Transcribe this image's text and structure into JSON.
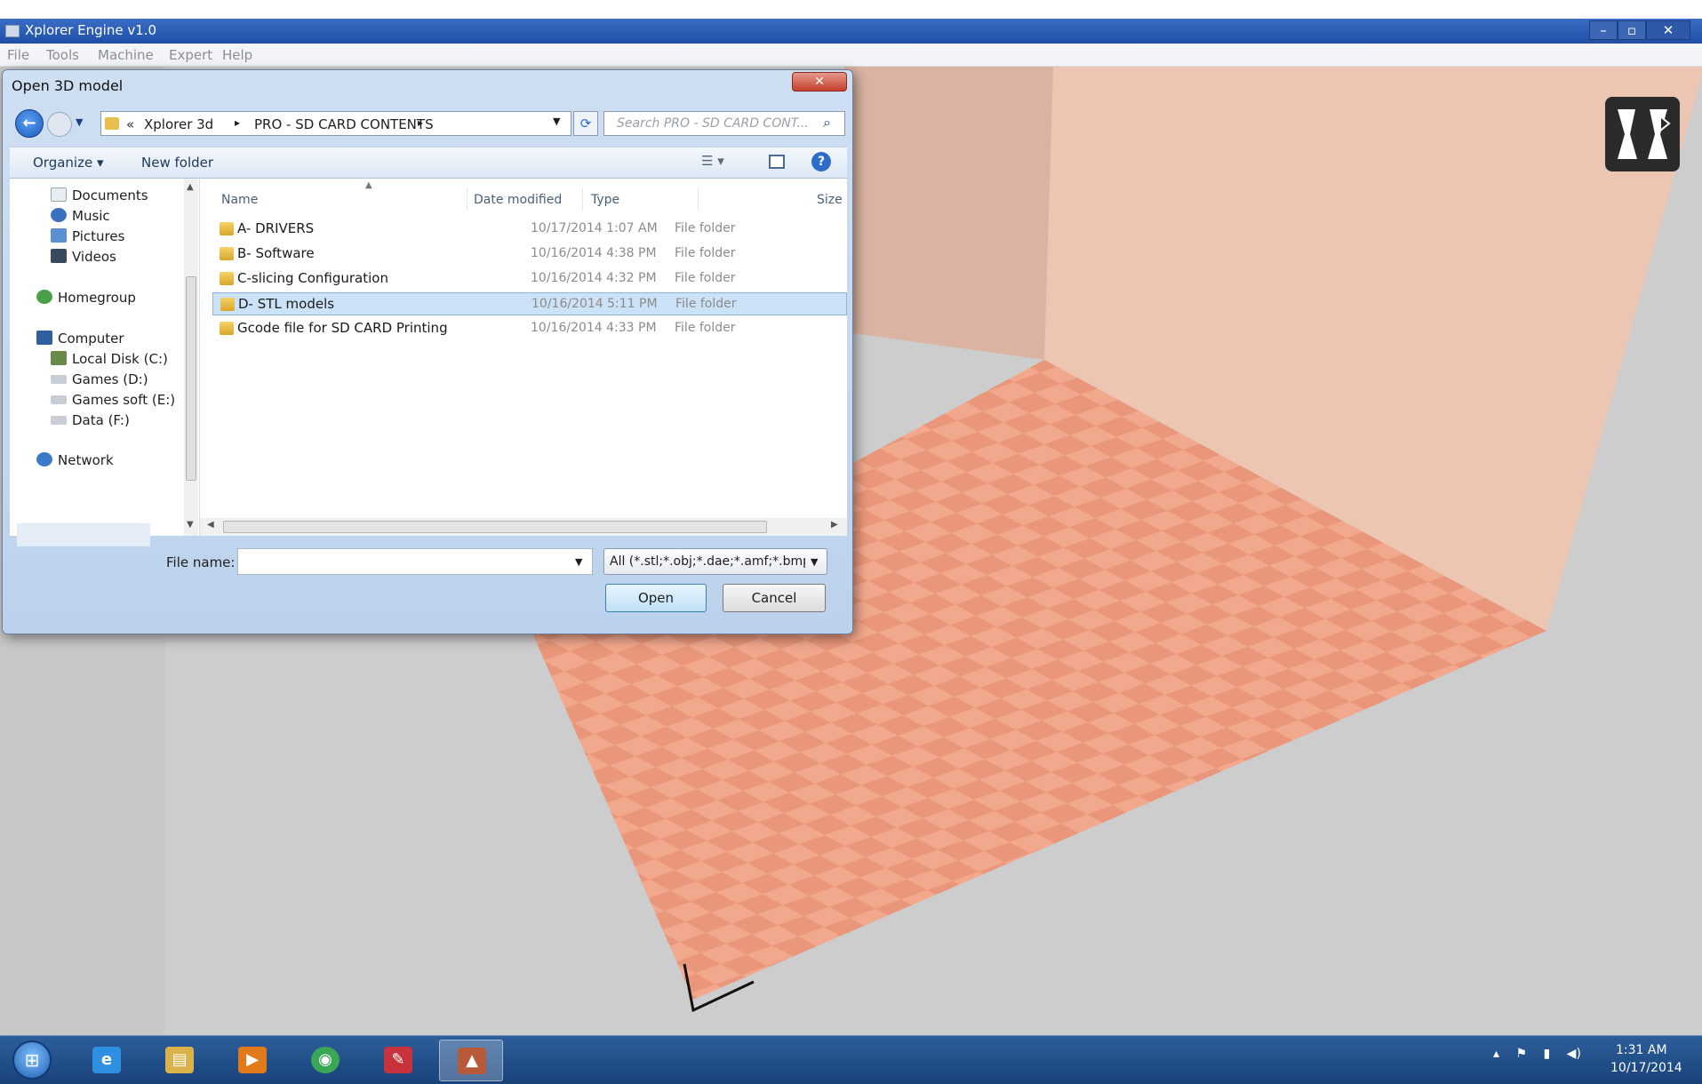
{
  "app": {
    "title": "Xplorer Engine v1.0",
    "menu": [
      "File",
      "Tools",
      "Machine",
      "Expert",
      "Help"
    ],
    "window_controls": {
      "minimize": "–",
      "maximize": "▫",
      "close": "✕"
    },
    "logo_icon": "xplorer-logo-icon"
  },
  "dialog": {
    "title": "Open 3D model",
    "close_glyph": "✕",
    "address": {
      "prefix": "«",
      "crumbs": [
        "Xplorer 3d",
        "PRO - SD CARD CONTENTS"
      ],
      "separator": "▸"
    },
    "search_placeholder": "Search PRO - SD CARD CONT...",
    "toolbar": {
      "organize": "Organize ▾",
      "new_folder": "New folder",
      "help": "?",
      "view": "☰ ▾"
    },
    "nav": {
      "libraries": [
        "Documents",
        "Music",
        "Pictures",
        "Videos"
      ],
      "homegroup": "Homegroup",
      "computer": "Computer",
      "drives": [
        "Local Disk (C:)",
        "Games (D:)",
        "Games soft (E:)",
        "Data (F:)"
      ],
      "network": "Network"
    },
    "columns": [
      "Name",
      "Date modified",
      "Type",
      "Size"
    ],
    "files": [
      {
        "name": "A- DRIVERS",
        "date": "10/17/2014 1:07 AM",
        "type": "File folder"
      },
      {
        "name": "B- Software",
        "date": "10/16/2014 4:38 PM",
        "type": "File folder"
      },
      {
        "name": "C-slicing Configuration",
        "date": "10/16/2014 4:32 PM",
        "type": "File folder"
      },
      {
        "name": "D- STL models",
        "date": "10/16/2014 5:11 PM",
        "type": "File folder"
      },
      {
        "name": "Gcode file for SD CARD Printing",
        "date": "10/16/2014 4:33 PM",
        "type": "File folder"
      }
    ],
    "selected_index": 3,
    "filename_label": "File name:",
    "filename_value": "",
    "filetype": "All (*.stl;*.obj;*.dae;*.amf;*.bmp",
    "open_label": "Open",
    "cancel_label": "Cancel"
  },
  "taskbar": {
    "start": "⊞",
    "apps": [
      {
        "name": "internet-explorer-icon",
        "glyph": "e",
        "color": "#2f8fe0"
      },
      {
        "name": "file-explorer-icon",
        "glyph": "▤",
        "color": "#d9b34a"
      },
      {
        "name": "media-player-icon",
        "glyph": "▶",
        "color": "#e07a1a"
      },
      {
        "name": "chrome-icon",
        "glyph": "◉",
        "color": "#3aa757"
      },
      {
        "name": "pdf-reader-icon",
        "glyph": "✎",
        "color": "#c8323a"
      },
      {
        "name": "xplorer-engine-icon",
        "glyph": "▲",
        "color": "#b85a3a"
      }
    ],
    "tray": [
      "▴",
      "⚑",
      "▮",
      "◀)"
    ],
    "time": "1:31 AM",
    "date": "10/17/2014"
  }
}
